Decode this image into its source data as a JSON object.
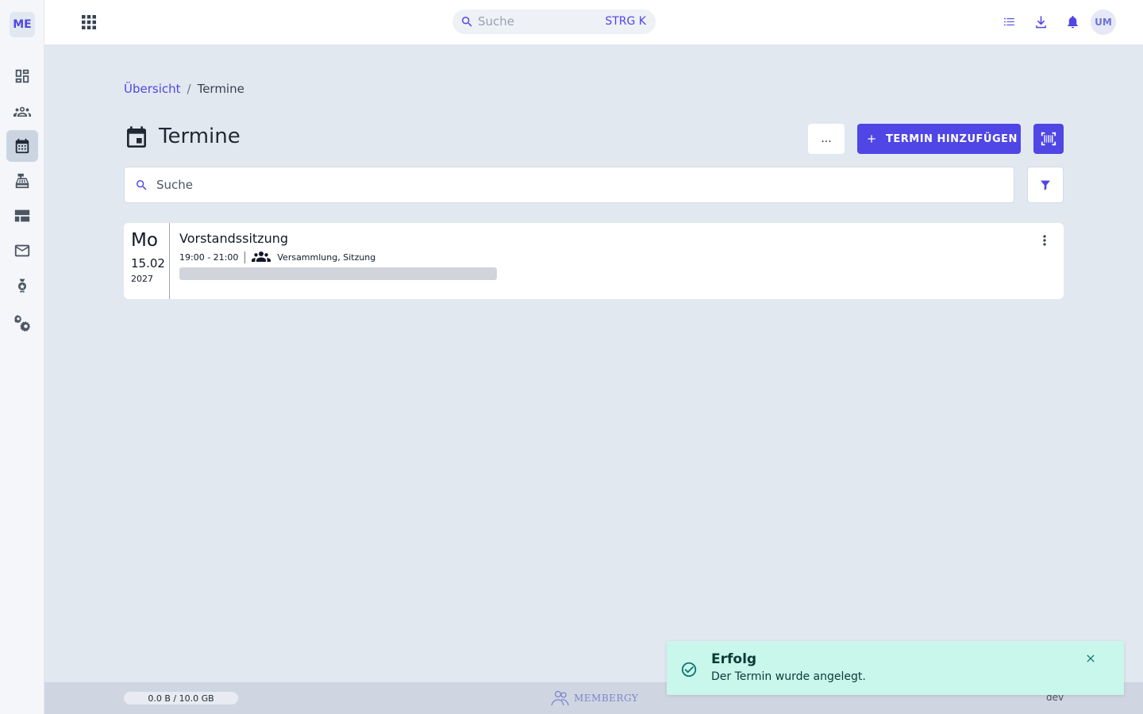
{
  "sidebar": {
    "brand": "ME",
    "items": [
      {
        "icon": "dashboard-icon"
      },
      {
        "icon": "members-icon"
      },
      {
        "icon": "calendar-icon",
        "active": true
      },
      {
        "icon": "cash-register-icon"
      },
      {
        "icon": "table-view-icon"
      },
      {
        "icon": "mail-icon"
      },
      {
        "icon": "award-icon"
      },
      {
        "icon": "settings-icon"
      }
    ]
  },
  "topbar": {
    "search_placeholder": "Suche",
    "search_shortcut": "STRG K",
    "avatar_initials": "UM"
  },
  "breadcrumb": {
    "parent": "Übersicht",
    "separator": "/",
    "current": "Termine"
  },
  "page": {
    "title": "Termine",
    "more_label": "...",
    "add_label": "TERMIN HINZUFÜGEN"
  },
  "list_search": {
    "placeholder": "Suche"
  },
  "events": [
    {
      "weekday": "Mo",
      "day_month": "15.02",
      "year": "2027",
      "title": "Vorstandssitzung",
      "time": "19:00 - 21:00",
      "categories": "Versammlung, Sitzung"
    }
  ],
  "footer": {
    "storage": "0.0 B / 10.0 GB",
    "logo_text": "MEMBERGY",
    "env": "dev"
  },
  "toast": {
    "title": "Erfolg",
    "message": "Der Termin wurde angelegt."
  },
  "colors": {
    "primary": "#4f46e5",
    "background": "#e2e8f0",
    "toast_success": "#c9f7ec"
  }
}
